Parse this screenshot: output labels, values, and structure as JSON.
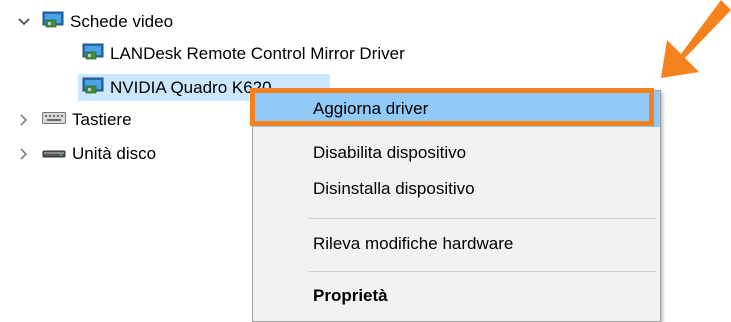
{
  "tree": {
    "items": [
      {
        "label": "Schede video",
        "state": "expanded",
        "icon": "display-adapter-icon"
      },
      {
        "label": "LANDesk Remote Control Mirror Driver",
        "state": "leaf",
        "icon": "display-adapter-icon"
      },
      {
        "label": "NVIDIA Quadro K620",
        "state": "leaf",
        "selected": true,
        "icon": "display-adapter-icon"
      },
      {
        "label": "Tastiere",
        "state": "collapsed",
        "icon": "keyboard-icon"
      },
      {
        "label": "Unità disco",
        "state": "collapsed",
        "icon": "disk-drive-icon"
      }
    ]
  },
  "context_menu": {
    "items": [
      {
        "label": "Aggiorna driver",
        "highlighted": true
      },
      {
        "label": "Disabilita dispositivo"
      },
      {
        "label": "Disinstalla dispositivo"
      },
      {
        "label": "Rileva modifiche hardware"
      },
      {
        "label": "Proprietà",
        "bold": true
      }
    ]
  },
  "colors": {
    "highlight_box": "#f5821f",
    "arrow": "#f5821f",
    "menu_background": "#f2f2f2",
    "menu_item_hover": "#91c9f7",
    "tree_selection": "#cce8ff"
  }
}
